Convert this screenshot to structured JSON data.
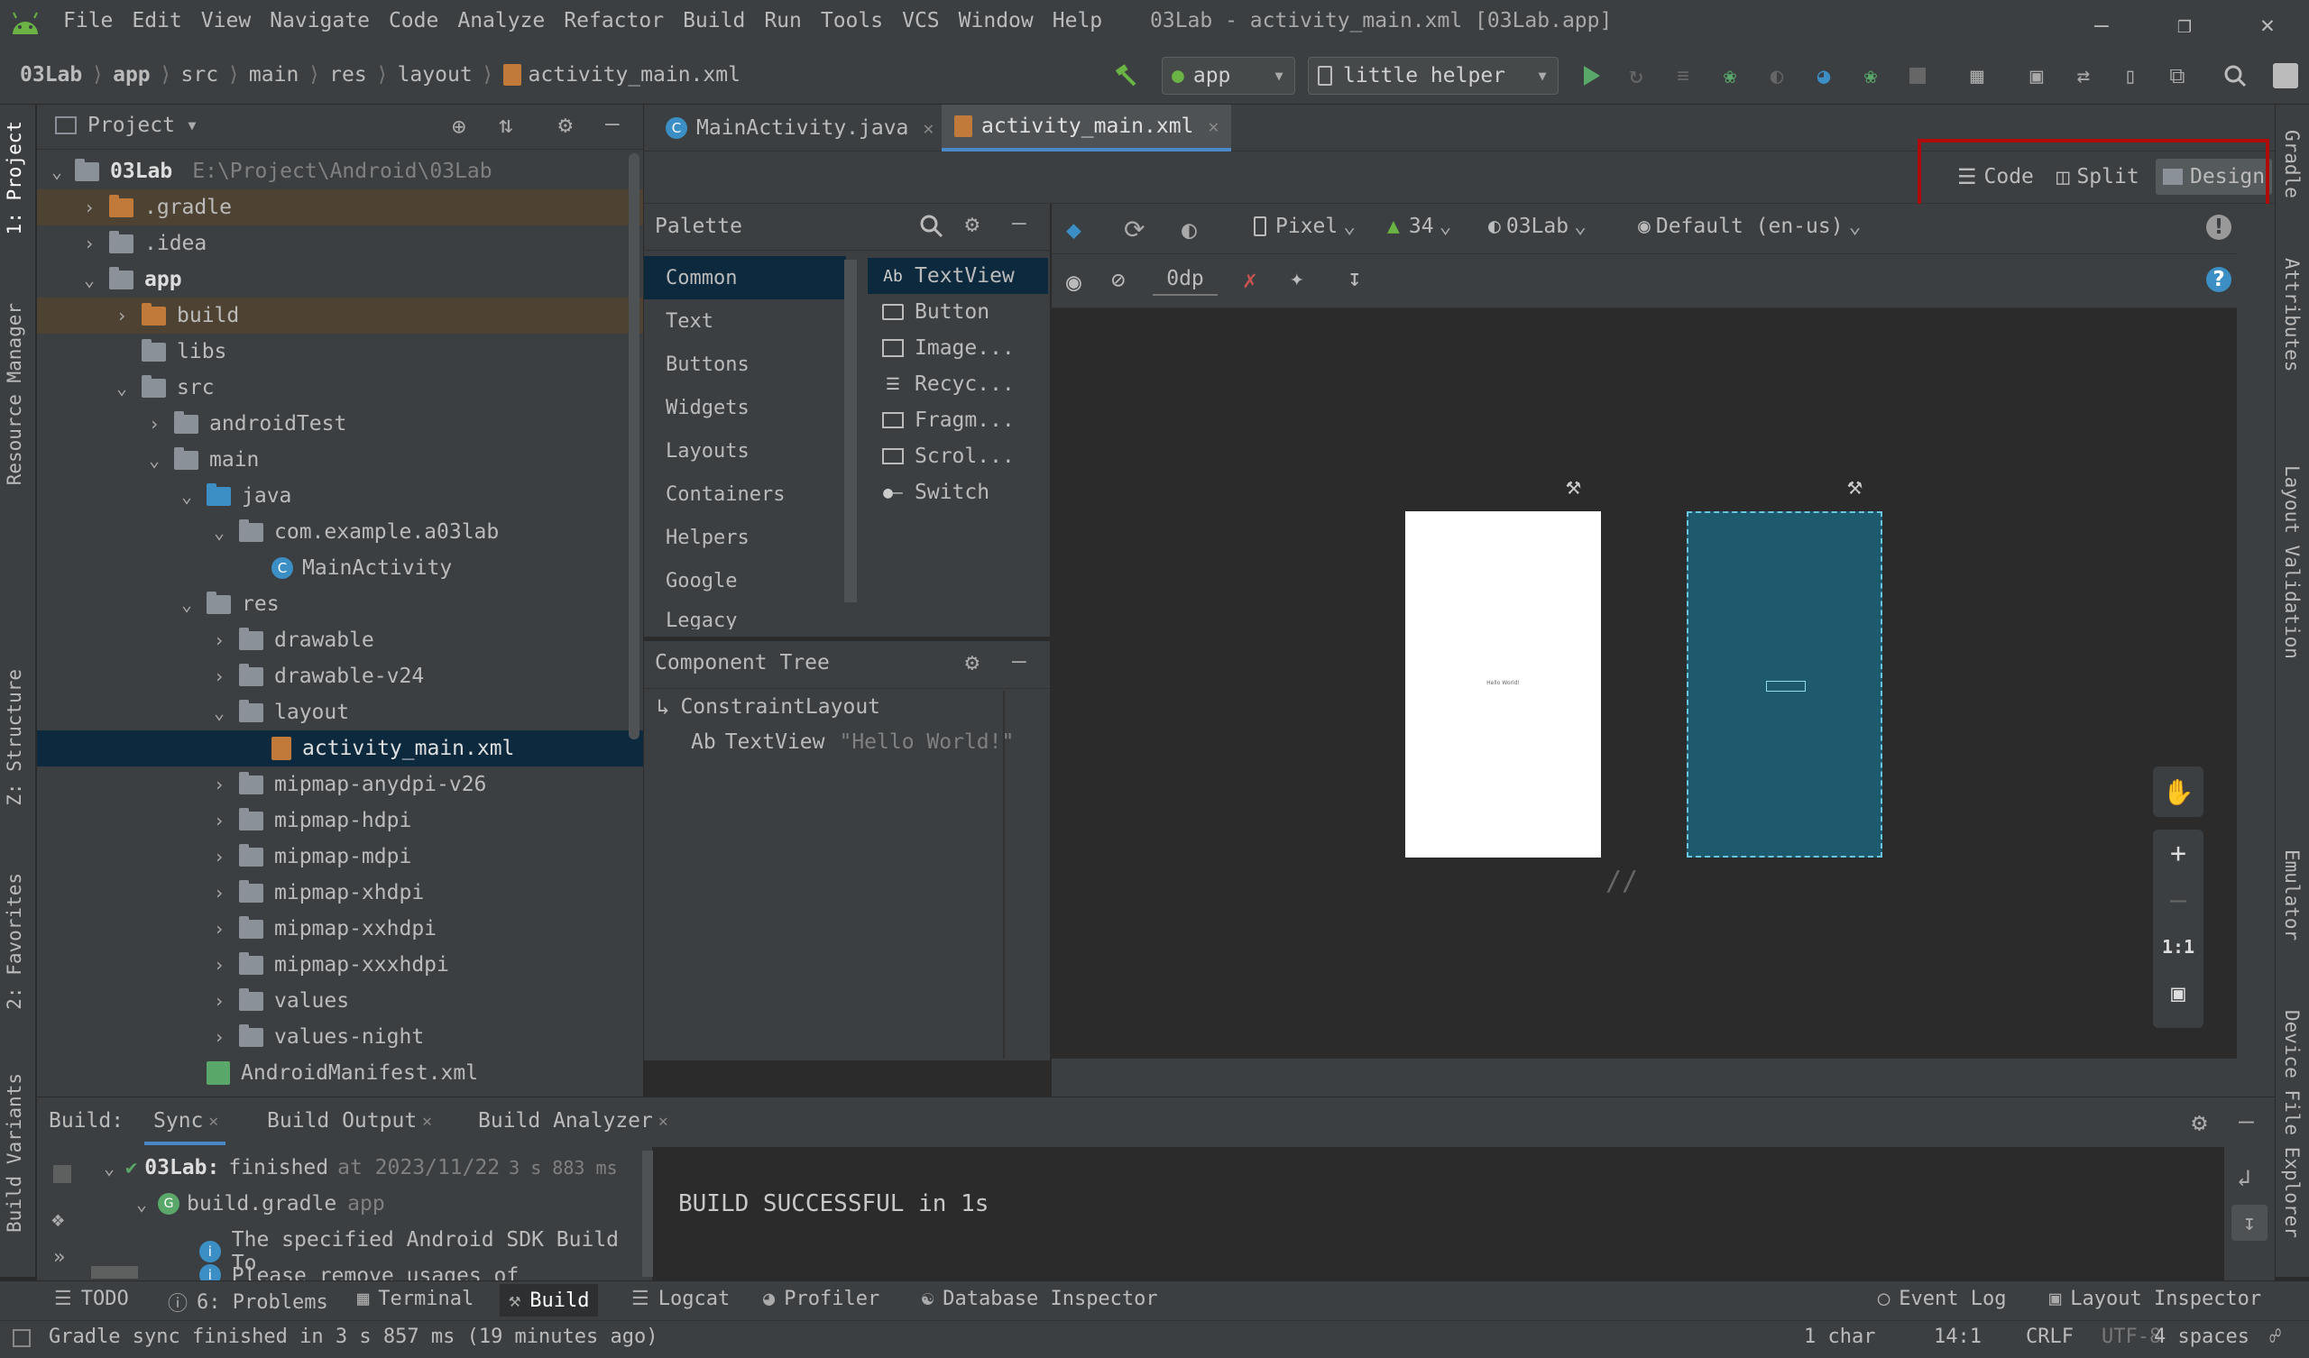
{
  "window": {
    "title": "03Lab - activity_main.xml [03Lab.app]",
    "menu": [
      "File",
      "Edit",
      "View",
      "Navigate",
      "Code",
      "Analyze",
      "Refactor",
      "Build",
      "Run",
      "Tools",
      "VCS",
      "Window",
      "Help"
    ]
  },
  "breadcrumb": [
    "03Lab",
    "app",
    "src",
    "main",
    "res",
    "layout",
    "activity_main.xml"
  ],
  "toolbar": {
    "run_config": "app",
    "device": "little helper"
  },
  "left_strip": [
    "1: Project",
    "Resource Manager",
    "Z: Structure",
    "2: Favorites",
    "Build Variants"
  ],
  "right_strip": [
    "Gradle",
    "Attributes",
    "Layout Validation",
    "Emulator",
    "Device File Explorer"
  ],
  "project": {
    "header": "Project",
    "root_name": "03Lab",
    "root_path": "E:\\Project\\Android\\03Lab",
    "items": [
      {
        "label": ".gradle",
        "hl": true
      },
      {
        "label": ".idea"
      },
      {
        "label": "app"
      },
      {
        "label": "build",
        "hl": true
      },
      {
        "label": "libs"
      },
      {
        "label": "src"
      },
      {
        "label": "androidTest"
      },
      {
        "label": "main"
      },
      {
        "label": "java"
      },
      {
        "label": "com.example.a03lab"
      },
      {
        "label": "MainActivity"
      },
      {
        "label": "res"
      },
      {
        "label": "drawable"
      },
      {
        "label": "drawable-v24"
      },
      {
        "label": "layout"
      },
      {
        "label": "activity_main.xml",
        "selected": true
      },
      {
        "label": "mipmap-anydpi-v26"
      },
      {
        "label": "mipmap-hdpi"
      },
      {
        "label": "mipmap-mdpi"
      },
      {
        "label": "mipmap-xhdpi"
      },
      {
        "label": "mipmap-xxhdpi"
      },
      {
        "label": "mipmap-xxxhdpi"
      },
      {
        "label": "values"
      },
      {
        "label": "values-night"
      },
      {
        "label": "AndroidManifest.xml"
      }
    ]
  },
  "editor_tabs": [
    {
      "label": "MainActivity.java",
      "active": false
    },
    {
      "label": "activity_main.xml",
      "active": true
    }
  ],
  "modes": {
    "code": "Code",
    "split": "Split",
    "design": "Design",
    "active": "Design"
  },
  "palette": {
    "title": "Palette",
    "categories": [
      "Common",
      "Text",
      "Buttons",
      "Widgets",
      "Layouts",
      "Containers",
      "Helpers",
      "Google",
      "Legacy"
    ],
    "selected_category": "Common",
    "items": [
      {
        "icon": "Ab",
        "label": "TextView"
      },
      {
        "icon": "button",
        "label": "Button"
      },
      {
        "icon": "image",
        "label": "Image..."
      },
      {
        "icon": "list",
        "label": "Recyc..."
      },
      {
        "icon": "fragment",
        "label": "Fragm..."
      },
      {
        "icon": "scroll",
        "label": "Scrol..."
      },
      {
        "icon": "switch",
        "label": "Switch"
      }
    ]
  },
  "component_tree": {
    "title": "Component Tree",
    "root": "ConstraintLayout",
    "child_label": "TextView",
    "child_text": "\"Hello World!\""
  },
  "design_toolbar": {
    "device": "Pixel",
    "api": "34",
    "theme": "03Lab",
    "locale": "Default (en-us)",
    "margin": "0dp"
  },
  "canvas": {
    "preview_text": "Hello World!",
    "zoom_1to1": "1:1"
  },
  "build": {
    "label": "Build:",
    "tabs": [
      "Sync",
      "Build Output",
      "Build Analyzer"
    ],
    "root": "03Lab:",
    "root_status": "finished",
    "root_time": "at 2023/11/22",
    "root_duration": "3 s 883 ms",
    "gradle_item": "build.gradle",
    "gradle_module": "app",
    "msg1": "The specified Android SDK Build To",
    "msg2": "Please remove usages of `jcenter()",
    "output": "BUILD SUCCESSFUL in 1s"
  },
  "bottom_tabs": [
    "TODO",
    "6: Problems",
    "Terminal",
    "Build",
    "Logcat",
    "Profiler",
    "Database Inspector",
    "Event Log",
    "Layout Inspector"
  ],
  "status": {
    "message": "Gradle sync finished in 3 s 857 ms (19 minutes ago)",
    "chars": "1 char",
    "position": "14:1",
    "line_sep": "CRLF",
    "encoding": "UTF-8",
    "indent": "4 spaces"
  },
  "colors": {
    "accent": "#4a88c7",
    "highlight_box": "#b00b0b",
    "blueprint": "#1e5a6e",
    "android_green": "#6ab344"
  }
}
